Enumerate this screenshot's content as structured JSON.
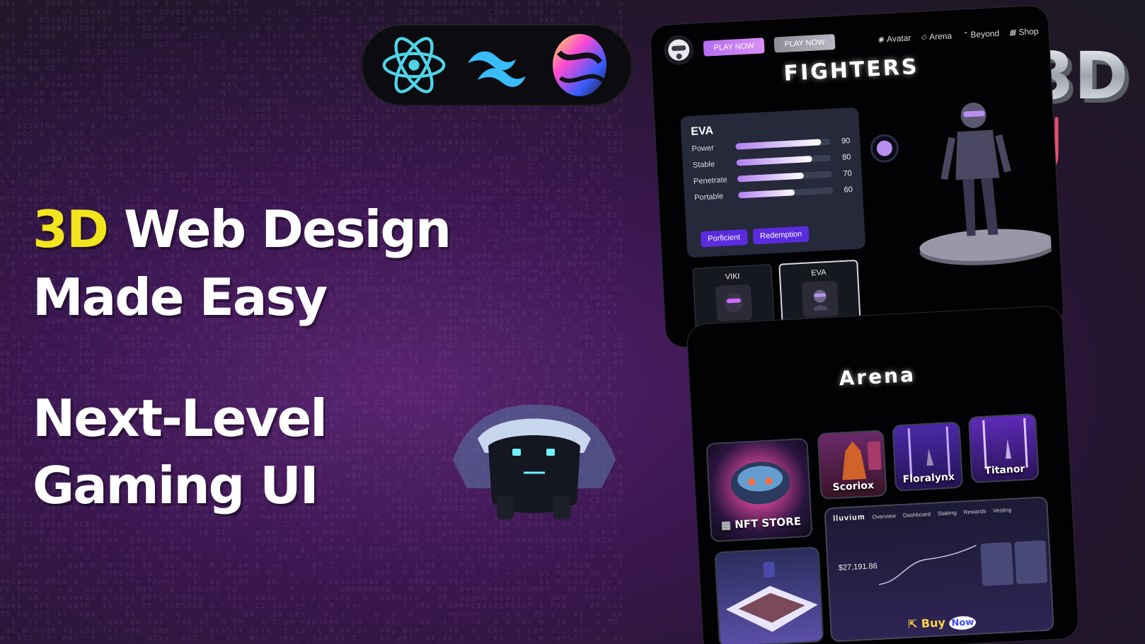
{
  "headline": {
    "line1_highlight": "3D",
    "line1_rest": " Web Design",
    "line2": "Made Easy",
    "line3": "Next-Level",
    "line4": "Gaming UI"
  },
  "badge_3d": "3D",
  "tech_stack": {
    "icons": [
      "react-icon",
      "tailwind-icon",
      "threejs-sphere-icon"
    ]
  },
  "nav": {
    "play_now_primary": "PLAY NOW",
    "play_now_secondary": "PLAY NOW",
    "links": [
      {
        "label": "Avatar",
        "icon": "user-icon"
      },
      {
        "label": "Arena",
        "icon": "diamond-icon"
      },
      {
        "label": "Beyond",
        "icon": "chevrons-up-icon"
      },
      {
        "label": "Shop",
        "icon": "shop-icon"
      }
    ]
  },
  "fighters": {
    "title": "FIGHTERS",
    "selected": "EVA",
    "stats": [
      {
        "label": "Power",
        "value": 90
      },
      {
        "label": "Stable",
        "value": 80
      },
      {
        "label": "Penetrate",
        "value": 70
      },
      {
        "label": "Portable",
        "value": 60
      }
    ],
    "buttons": [
      "Porficient",
      "Redemption"
    ],
    "cards": [
      {
        "name": "VIKI",
        "stars": "★★★",
        "active": false
      },
      {
        "name": "EVA",
        "stars": "★★★★",
        "active": true
      }
    ]
  },
  "arena": {
    "title": "Arena",
    "tiles": {
      "nft_store": "NFT STORE",
      "scoriox": "Scoriox",
      "floralynx": "Floralynx",
      "titanor": "Titanor"
    },
    "dashboard": {
      "brand": "lluvium",
      "tabs": [
        "Overview",
        "Dashboard",
        "Staking",
        "Rewards",
        "Vesting"
      ],
      "amount": "$27,191.86",
      "buy": "Buy",
      "now": "Now"
    }
  },
  "colors": {
    "highlight_yellow": "#f2e51d",
    "accent_purple": "#b36ef0",
    "button_violet": "#5b2be0",
    "arrow_pink": "#e8506e"
  }
}
